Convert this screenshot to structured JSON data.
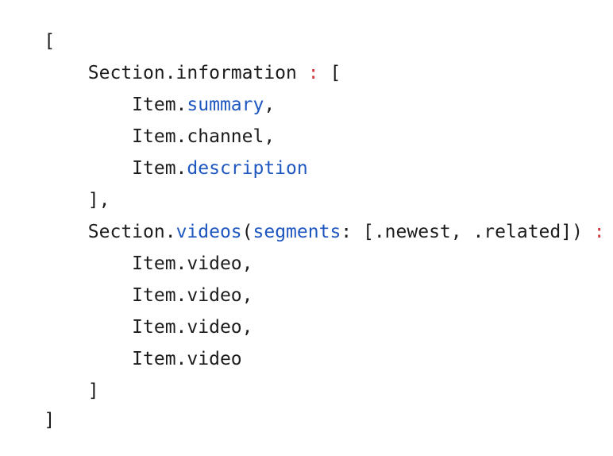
{
  "colors": {
    "background": "#ffffff",
    "plain": "#1c1c1c",
    "identifier": "#1f57c0",
    "operator": "#d6373f"
  },
  "code": {
    "lines": [
      {
        "tokens": [
          {
            "text": "[",
            "kind": "plain"
          }
        ]
      },
      {
        "tokens": [
          {
            "text": "    Section.information ",
            "kind": "plain"
          },
          {
            "text": ":",
            "kind": "operator"
          },
          {
            "text": " [",
            "kind": "plain"
          }
        ]
      },
      {
        "tokens": [
          {
            "text": "        Item.",
            "kind": "plain"
          },
          {
            "text": "summary",
            "kind": "identifier"
          },
          {
            "text": ",",
            "kind": "plain"
          }
        ]
      },
      {
        "tokens": [
          {
            "text": "        Item.channel,",
            "kind": "plain"
          }
        ]
      },
      {
        "tokens": [
          {
            "text": "        Item.",
            "kind": "plain"
          },
          {
            "text": "description",
            "kind": "identifier"
          }
        ]
      },
      {
        "tokens": [
          {
            "text": "    ],",
            "kind": "plain"
          }
        ]
      },
      {
        "tokens": [
          {
            "text": "    Section.",
            "kind": "plain"
          },
          {
            "text": "videos",
            "kind": "identifier"
          },
          {
            "text": "(",
            "kind": "plain"
          },
          {
            "text": "segments",
            "kind": "identifier"
          },
          {
            "text": ": [.newest, .related]) ",
            "kind": "plain"
          },
          {
            "text": ":",
            "kind": "operator"
          },
          {
            "text": " [",
            "kind": "plain"
          }
        ]
      },
      {
        "tokens": [
          {
            "text": "        Item.video,",
            "kind": "plain"
          }
        ]
      },
      {
        "tokens": [
          {
            "text": "        Item.video,",
            "kind": "plain"
          }
        ]
      },
      {
        "tokens": [
          {
            "text": "        Item.video,",
            "kind": "plain"
          }
        ]
      },
      {
        "tokens": [
          {
            "text": "        Item.video",
            "kind": "plain"
          }
        ]
      },
      {
        "tokens": [
          {
            "text": "    ]",
            "kind": "plain"
          }
        ]
      },
      {
        "tokens": [
          {
            "text": "]",
            "kind": "plain"
          }
        ]
      }
    ]
  }
}
